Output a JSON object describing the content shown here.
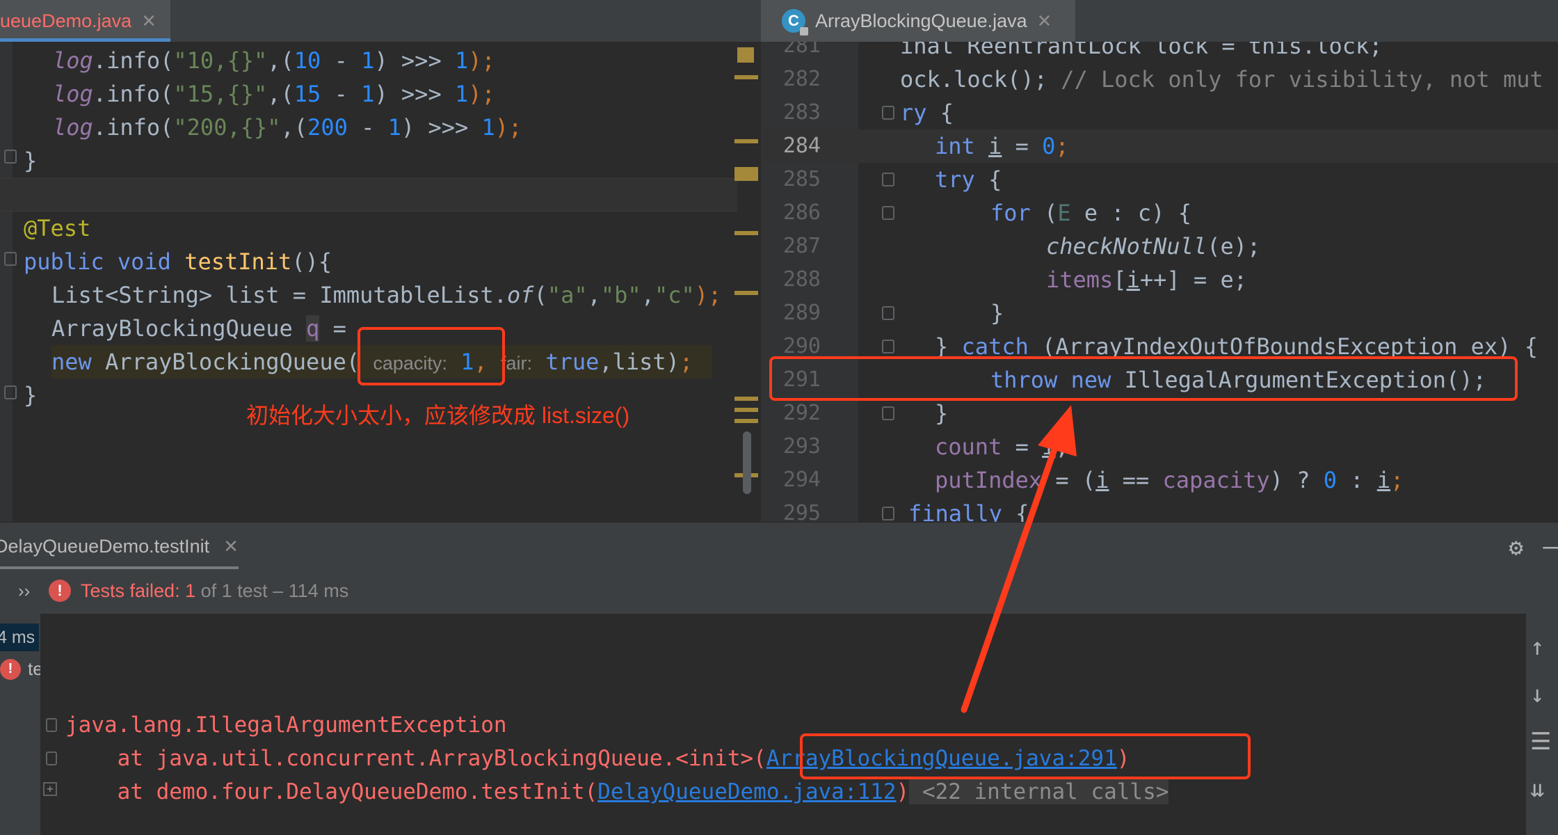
{
  "tabs": {
    "left_title": "ueueDemo.java",
    "right_title": "ArrayBlockingQueue.java",
    "right_icon_letter": "C",
    "close_glyph": "✕"
  },
  "left_editor": {
    "l1": {
      "obj": "log",
      "method": ".info(",
      "str": "\"10,{}\"",
      "mid": ",(",
      "n1": "10",
      "op": " - ",
      "n2": "1",
      "shift": ") >>> ",
      "n3": "1",
      "end": ");"
    },
    "l2": {
      "obj": "log",
      "method": ".info(",
      "str": "\"15,{}\"",
      "mid": ",(",
      "n1": "15",
      "op": " - ",
      "n2": "1",
      "shift": ") >>> ",
      "n3": "1",
      "end": ");"
    },
    "l3": {
      "obj": "log",
      "method": ".info(",
      "str": "\"200,{}\"",
      "mid": ",(",
      "n1": "200",
      "op": " - ",
      "n2": "1",
      "shift": ") >>> ",
      "n3": "1",
      "end": ");"
    },
    "l4": "}",
    "l5": "@Test",
    "l6": {
      "kw1": "public",
      "kw2": " void ",
      "name": "testInit",
      "rest": "(){"
    },
    "l7": {
      "a": "List<String> list = ImmutableList.",
      "of": "of",
      "b": "(",
      "s1": "\"a\"",
      "c1": ",",
      "s2": "\"b\"",
      "c2": ",",
      "s3": "\"c\"",
      "end": ");"
    },
    "l8": {
      "a": "ArrayBlockingQueue ",
      "q": "q",
      "b": " ="
    },
    "l9": {
      "kw": "new",
      "a": " ArrayBlockingQueue(",
      "hint_capacity": "capacity:",
      "n": "1",
      "comma": ",",
      "hint_fair": "fair:",
      "t": "true",
      "rest": ",list)",
      "end": ";"
    },
    "l10": "}",
    "annotation": "初始化大小太小，应该修改成 list.size()"
  },
  "right_editor": {
    "lines": [
      {
        "num": "281",
        "text": "inal ReentrantLock lock = this.lock;"
      },
      {
        "num": "282",
        "a": "ock.lock();",
        "comment": " // Lock only for visibility, not mut"
      },
      {
        "num": "283",
        "kw": "ry",
        "rest": " {"
      },
      {
        "num": "284",
        "kw": "int",
        "v": "i",
        "a": " = ",
        "n": "0",
        "end": ";"
      },
      {
        "num": "285",
        "kw": "try",
        "rest": " {"
      },
      {
        "num": "286",
        "kw": "for",
        "a": " (",
        "e": "E",
        "b": " e : c) {"
      },
      {
        "num": "287",
        "fn": "checkNotNull",
        "rest": "(e);"
      },
      {
        "num": "288",
        "field": "items",
        "a": "[",
        "v": "i",
        "b": "++] = e;"
      },
      {
        "num": "289",
        "text": "}"
      },
      {
        "num": "290",
        "a": "} ",
        "kw": "catch",
        "b": " (ArrayIndexOutOfBoundsException ex) {"
      },
      {
        "num": "291",
        "kw1": "throw",
        "kw2": " new",
        "rest": " IllegalArgumentException();"
      },
      {
        "num": "292",
        "text": "}"
      },
      {
        "num": "293",
        "field": "count",
        "rest": " = ",
        "v": "i",
        "end": ";"
      },
      {
        "num": "294",
        "field": "putIndex",
        "a": " = (",
        "v": "i",
        "b": " == ",
        "cap": "capacity",
        "c": ") ? ",
        "n": "0",
        "d": " : ",
        "v2": "i",
        "end": ";"
      },
      {
        "num": "295",
        "kw": "finally",
        "rest": " {"
      }
    ],
    "current_line": "284"
  },
  "run_panel": {
    "tab_title": "DelayQueueDemo.testInit",
    "expand_glyph": "››",
    "status_failed": "Tests failed: 1",
    "status_rest": " of 1 test – 114 ms",
    "tree_time": "4 ms",
    "tree_item": "te",
    "console": {
      "exception": "java.lang.IllegalArgumentException",
      "at1_prefix": "    at java.util.concurrent.ArrayBlockingQueue.<init>(",
      "at1_link": "ArrayBlockingQueue.java:291",
      "at1_suffix": ")",
      "at2_prefix": "    at demo.four.DelayQueueDemo.testInit(",
      "at2_link": "DelayQueueDemo.java:112",
      "at2_suffix": ")",
      "folded": " <22 internal calls>"
    }
  },
  "colors": {
    "annotation_red": "#ff3b1c",
    "error_red": "#ff6b68",
    "link_blue": "#287bde"
  }
}
